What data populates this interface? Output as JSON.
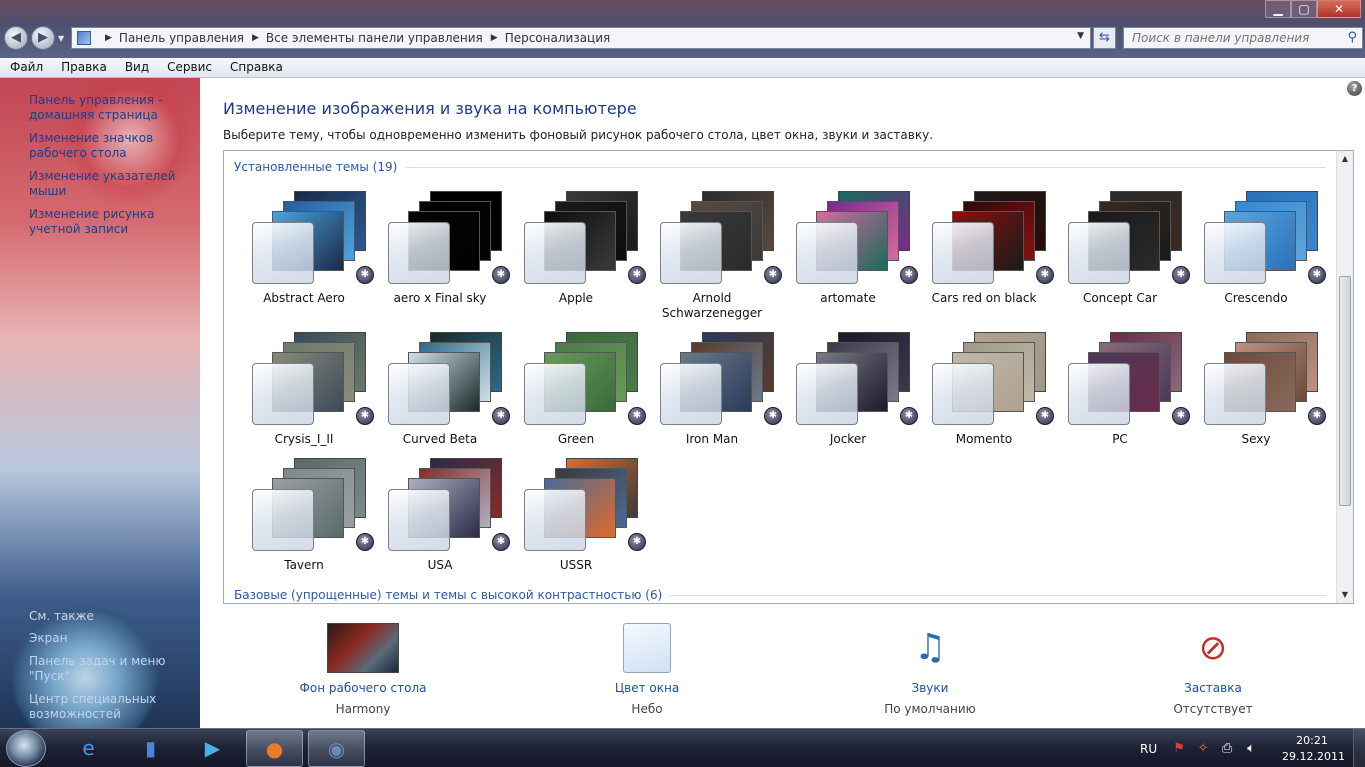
{
  "window": {
    "minimize": "▁",
    "maximize": "▢",
    "close": "✕"
  },
  "nav": {
    "back": "◀",
    "forward": "▶"
  },
  "address": {
    "crumbs": [
      "Панель управления",
      "Все элементы панели управления",
      "Персонализация"
    ]
  },
  "search": {
    "placeholder": "Поиск в панели управления"
  },
  "menu": [
    "Файл",
    "Правка",
    "Вид",
    "Сервис",
    "Справка"
  ],
  "left_pane": {
    "links": [
      "Панель управления - домашняя страница",
      "Изменение значков рабочего стола",
      "Изменение указателей мыши",
      "Изменение рисунка учетной записи"
    ],
    "see_also_header": "См. также",
    "see_also": [
      "Экран",
      "Панель задач и меню \"Пуск\"",
      "Центр специальных возможностей"
    ]
  },
  "main": {
    "title": "Изменение изображения и звука на компьютере",
    "description": "Выберите тему, чтобы одновременно изменить фоновый рисунок рабочего стола, цвет окна, звуки и заставку.",
    "installed_header": "Установленные темы (19)",
    "basic_header": "Базовые (упрощенные) темы и темы с высокой контрастностью (6)",
    "themes": [
      {
        "name": "Abstract Aero",
        "colors": [
          "#1a2a48",
          "#2c5a94",
          "#4aa3e0"
        ]
      },
      {
        "name": "aero x Final sky",
        "colors": [
          "#000000",
          "#000000",
          "#050505"
        ]
      },
      {
        "name": "Apple",
        "colors": [
          "#3a3a3a",
          "#1a1a1a",
          "#0d0d0d"
        ]
      },
      {
        "name": "Arnold Schwarzenegger",
        "colors": [
          "#2b2b2b",
          "#5a4a40",
          "#3a3a3a"
        ]
      },
      {
        "name": "artomate",
        "colors": [
          "#1a6a5a",
          "#7a2a8a",
          "#d66aa0"
        ]
      },
      {
        "name": "Cars red on black",
        "colors": [
          "#1a1a1a",
          "#2a0a0a",
          "#8a1010"
        ]
      },
      {
        "name": "Concept Car",
        "colors": [
          "#2a2a2a",
          "#3a2a20",
          "#1a1a1a"
        ]
      },
      {
        "name": "Crescendo",
        "colors": [
          "#2a70b8",
          "#3a86cc",
          "#5aa6e0"
        ]
      },
      {
        "name": "Crysis_I_II",
        "colors": [
          "#3a4a5a",
          "#6a7a6a",
          "#8a8a7a"
        ]
      },
      {
        "name": "Curved Beta",
        "colors": [
          "#1a2a2a",
          "#2a6a8a",
          "#d0e0e8"
        ]
      },
      {
        "name": "Green",
        "colors": [
          "#3a6a3a",
          "#4a7a4a",
          "#6a9a5a"
        ]
      },
      {
        "name": "Iron Man",
        "colors": [
          "#2a3a5a",
          "#5a3a2a",
          "#6a7a8a"
        ]
      },
      {
        "name": "Jocker",
        "colors": [
          "#1a1a2a",
          "#3a3a4a",
          "#7a7a8a"
        ]
      },
      {
        "name": "Momento",
        "colors": [
          "#b0a090",
          "#a09888",
          "#c0b8a8"
        ]
      },
      {
        "name": "PC",
        "colors": [
          "#6a2a4a",
          "#8a6a7a",
          "#4a3a5a"
        ]
      },
      {
        "name": "Sexy",
        "colors": [
          "#8a6a5a",
          "#c09080",
          "#6a4a3a"
        ]
      },
      {
        "name": "Tavern",
        "colors": [
          "#5a6a6a",
          "#7a8a8a",
          "#9aa0a0"
        ]
      },
      {
        "name": "USA",
        "colors": [
          "#2a2a4a",
          "#8a2a2a",
          "#b0b0c0"
        ]
      },
      {
        "name": "USSR",
        "colors": [
          "#e06a2a",
          "#3a3a3a",
          "#4a6a9a"
        ]
      }
    ],
    "badge_glyph": "✱"
  },
  "settings": [
    {
      "label": "Фон рабочего стола",
      "value": "Harmony",
      "icon": "desktop-background-icon"
    },
    {
      "label": "Цвет окна",
      "value": "Небо",
      "icon": "window-color-icon"
    },
    {
      "label": "Звуки",
      "value": "По умолчанию",
      "icon": "sounds-icon"
    },
    {
      "label": "Заставка",
      "value": "Отсутствует",
      "icon": "screensaver-icon"
    }
  ],
  "taskbar": {
    "apps": [
      {
        "name": "Internet Explorer",
        "glyph": "e",
        "color": "#3aa0e8"
      },
      {
        "name": "Explorer",
        "glyph": "▮",
        "color": "#4a86d8"
      },
      {
        "name": "Media Player",
        "glyph": "▶",
        "color": "#4ab0e8"
      },
      {
        "name": "Firefox",
        "glyph": "●",
        "color": "#e87a2a"
      },
      {
        "name": "Control Panel",
        "glyph": "◉",
        "color": "#6a8ab0"
      }
    ],
    "language": "RU",
    "time": "20:21",
    "date": "29.12.2011"
  }
}
